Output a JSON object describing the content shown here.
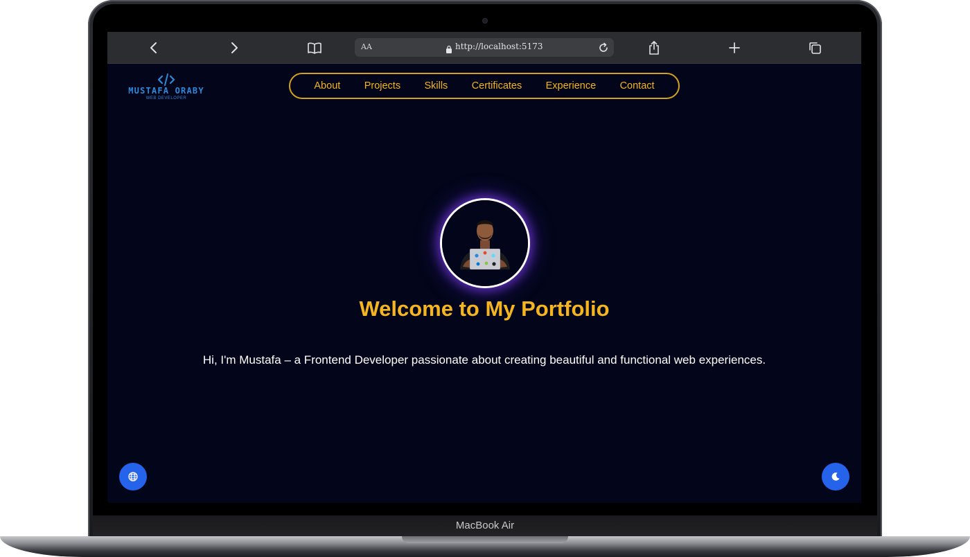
{
  "browser": {
    "text_size_label": "AA",
    "url": "http://localhost:5173"
  },
  "site": {
    "logo_name": "MUSTAFA ORABY",
    "logo_subtitle": "WEB DEVELOPER",
    "nav": [
      "About",
      "Projects",
      "Skills",
      "Certificates",
      "Experience",
      "Contact"
    ],
    "title": "Welcome to My Portfolio",
    "intro": "Hi, I'm Mustafa – a Frontend Developer passionate about creating beautiful and functional web experiences."
  },
  "device": {
    "label": "MacBook Air"
  },
  "colors": {
    "accent": "#f5b521",
    "background": "#03061a",
    "button": "#2563eb",
    "logo": "#2d89d9"
  },
  "icons": {
    "left_fab": "globe-icon",
    "right_fab": "moon-icon"
  }
}
